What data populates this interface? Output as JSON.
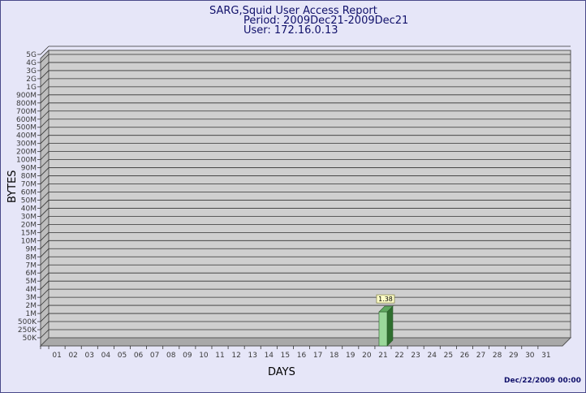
{
  "chart_data": {
    "type": "bar",
    "title_lines": [
      "SARG,Squid User Access Report",
      "Period: 2009Dec21-2009Dec21",
      "User: 172.16.0.13"
    ],
    "xlabel": "DAYS",
    "ylabel": "BYTES",
    "categories": [
      "01",
      "02",
      "03",
      "04",
      "05",
      "06",
      "07",
      "08",
      "09",
      "10",
      "11",
      "12",
      "13",
      "14",
      "15",
      "16",
      "17",
      "18",
      "19",
      "20",
      "21",
      "22",
      "23",
      "24",
      "25",
      "26",
      "27",
      "28",
      "29",
      "30",
      "31"
    ],
    "y_ticks": [
      "50K",
      "250K",
      "500K",
      "1M",
      "2M",
      "3M",
      "4M",
      "5M",
      "6M",
      "7M",
      "8M",
      "9M",
      "10M",
      "15M",
      "20M",
      "30M",
      "40M",
      "50M",
      "60M",
      "70M",
      "80M",
      "90M",
      "100M",
      "200M",
      "300M",
      "400M",
      "500M",
      "600M",
      "700M",
      "800M",
      "900M",
      "1G",
      "2G",
      "3G",
      "4G",
      "5G"
    ],
    "bars": [
      {
        "category": "21",
        "value": "1.38M",
        "label": "1.38",
        "tick_position": 3.4
      }
    ],
    "grid": true,
    "bar_color": "#9ad89a",
    "background": "#cfcfcf",
    "timestamp": "Dec/22/2009 00:00"
  }
}
